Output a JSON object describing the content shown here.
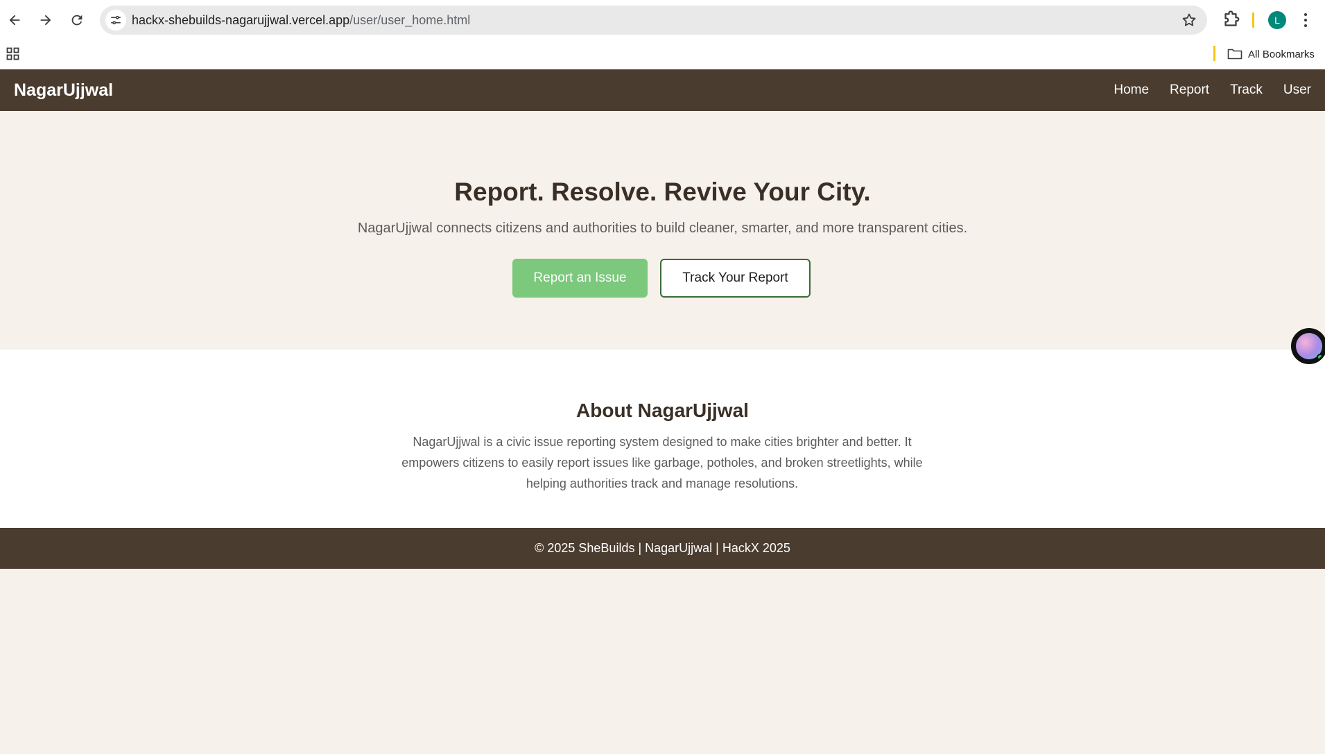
{
  "browser": {
    "url_host": "hackx-shebuilds-nagarujjwal.vercel.app",
    "url_path": "/user/user_home.html",
    "profile_initial": "L",
    "bookmarks_label": "All Bookmarks",
    "icons": [
      "back-icon",
      "forward-icon",
      "reload-icon",
      "site-info-icon",
      "star-icon",
      "extensions-icon",
      "menu-icon",
      "apps-icon",
      "folder-icon"
    ]
  },
  "site": {
    "brand": "NagarUjjwal",
    "nav": [
      "Home",
      "Report",
      "Track",
      "User"
    ],
    "hero": {
      "title": "Report. Resolve. Revive Your City.",
      "subtitle": "NagarUjjwal connects citizens and authorities to build cleaner, smarter, and more transparent cities.",
      "primary_button": "Report an Issue",
      "secondary_button": "Track Your Report"
    },
    "about": {
      "title": "About NagarUjjwal",
      "body": "NagarUjjwal is a civic issue reporting system designed to make cities brighter and better. It empowers citizens to easily report issues like garbage, potholes, and broken streetlights, while helping authorities track and manage resolutions."
    },
    "footer": "© 2025 SheBuilds | NagarUjjwal | HackX 2025",
    "colors": {
      "header_bg": "#4a3c2f",
      "hero_bg": "#f6f1ea",
      "primary_button": "#7cc87c",
      "secondary_border": "#3b6b35"
    }
  }
}
